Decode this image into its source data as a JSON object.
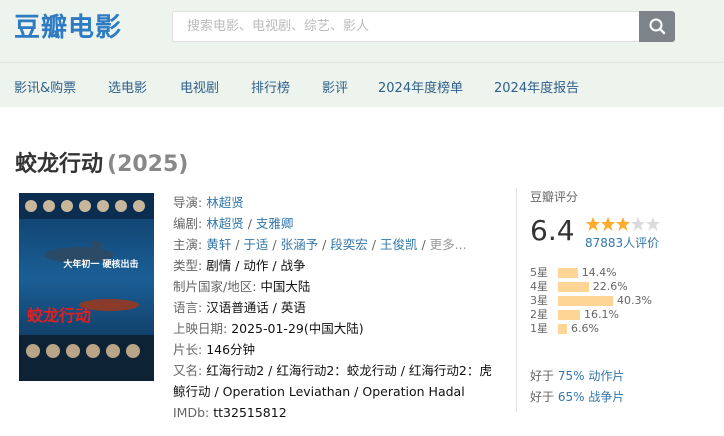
{
  "site": {
    "logo": "豆瓣电影"
  },
  "search": {
    "placeholder": "搜索电影、电视剧、综艺、影人"
  },
  "nav": [
    "影讯&购票",
    "选电影",
    "电视剧",
    "排行榜",
    "影评",
    "2024年度榜单",
    "2024年度报告"
  ],
  "movie": {
    "title": "蛟龙行动",
    "year": "(2025)",
    "poster": {
      "tagline": "大年初一 硬核出击",
      "title_art": "蛟龙行动"
    },
    "director": {
      "label": "导演:",
      "value": "林超贤"
    },
    "writers": {
      "label": "编剧:",
      "values": [
        "林超贤",
        "支雅卿"
      ]
    },
    "cast": {
      "label": "主演:",
      "values": [
        "黄轩",
        "于适",
        "张涵予",
        "段奕宏",
        "王俊凯"
      ],
      "more": "更多..."
    },
    "genre": {
      "label": "类型:",
      "value": "剧情 / 动作 / 战争"
    },
    "country": {
      "label": "制片国家/地区:",
      "value": "中国大陆"
    },
    "language": {
      "label": "语言:",
      "value": "汉语普通话 / 英语"
    },
    "release": {
      "label": "上映日期:",
      "value": "2025-01-29(中国大陆)"
    },
    "runtime": {
      "label": "片长:",
      "value": "146分钟"
    },
    "aka": {
      "label": "又名:",
      "value": "红海行动2 / 红海行动2：蛟龙行动 / 红海行动2：虎鲸行动 / Operation Leviathan / Operation Hadal"
    },
    "imdb": {
      "label": "IMDb:",
      "value": "tt32515812"
    }
  },
  "rating": {
    "title": "豆瓣评分",
    "score": "6.4",
    "stars": 3,
    "votes": "87883人评价",
    "breakdown": [
      {
        "label": "5星",
        "pct": "14.4%",
        "value": 14.4
      },
      {
        "label": "4星",
        "pct": "22.6%",
        "value": 22.6
      },
      {
        "label": "3星",
        "pct": "40.3%",
        "value": 40.3
      },
      {
        "label": "2星",
        "pct": "16.1%",
        "value": 16.1
      },
      {
        "label": "1星",
        "pct": "6.6%",
        "value": 6.6
      }
    ],
    "better": [
      {
        "prefix": "好于",
        "link": "75% 动作片"
      },
      {
        "prefix": "好于",
        "link": "65% 战争片"
      }
    ]
  },
  "colors": {
    "brand": "#2e7bc4",
    "link": "#3377aa",
    "bar": "#ffd596",
    "star": "#ffac2d",
    "header_bg": "#edf4ed"
  }
}
